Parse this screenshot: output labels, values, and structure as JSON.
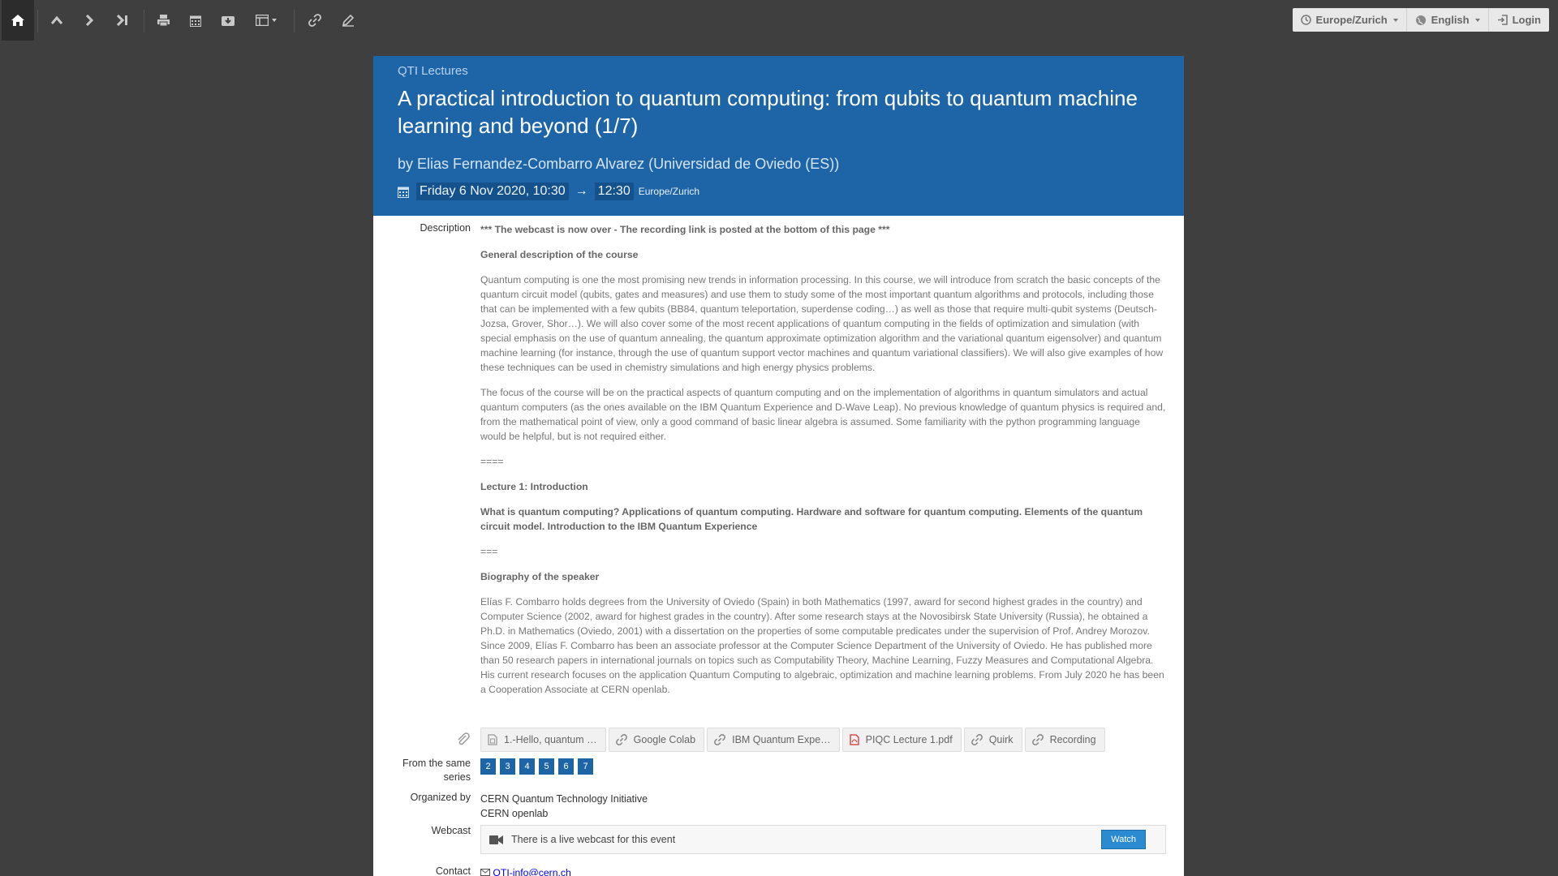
{
  "toolbar": {
    "timezone": "Europe/Zurich",
    "language": "English",
    "login": "Login",
    "icons": [
      "home-icon",
      "arrow-up-icon",
      "chevron-right-icon",
      "skip-last-icon",
      "print-icon",
      "calendar-icon",
      "download-icon",
      "layout-icon",
      "link-icon",
      "edit-icon"
    ]
  },
  "event": {
    "series": "QTI Lectures",
    "title": "A practical introduction to quantum computing: from qubits to quantum machine learning and beyond (1/7)",
    "speaker": "by Elias Fernandez-Combarro Alvarez (Universidad de Oviedo (ES))",
    "start": "Friday 6 Nov 2020, 10:30",
    "arrow": "→",
    "end": "12:30",
    "tz": "Europe/Zurich"
  },
  "description": {
    "label": "Description",
    "paragraphs": [
      "*** The webcast is now over - The recording link is posted at the bottom of this page ***",
      "General description of the course",
      "Quantum computing is one the most promising new trends in information processing. In this course, we will introduce from scratch the basic concepts of the quantum circuit model (qubits, gates and measures) and use them to study some of the most important quantum algorithms and protocols, including those that can be implemented with a few qubits (BB84, quantum teleportation, superdense coding…) as well as those that require multi-qubit systems (Deutsch-Jozsa, Grover, Shor…). We will also cover some of the most recent applications of quantum computing in the fields of optimization and simulation (with special emphasis on the use of quantum annealing, the quantum approximate optimization algorithm and the variational quantum eigensolver) and quantum machine learning (for instance, through the use of quantum support vector machines and quantum variational classifiers). We will also give examples of how these techniques can be used in chemistry simulations and high energy physics problems.",
      "The focus of the course will be on the practical aspects of quantum computing and on the implementation of algorithms in quantum simulators and actual quantum computers (as the ones available on the IBM Quantum Experience and D-Wave Leap). No previous knowledge of quantum physics is required and, from the mathematical point of view, only a good command of basic linear algebra is assumed. Some familiarity with the python programming language would be helpful, but is not required either.",
      "====",
      "Lecture 1: Introduction",
      "What is quantum computing? Applications of quantum computing. Hardware and software for quantum computing. Elements of the quantum circuit model. Introduction to the IBM Quantum Experience",
      "===",
      "Biography of the speaker",
      "Elías F. Combarro holds degrees from the University of Oviedo (Spain) in both Mathematics (1997, award for second highest grades in the country) and Computer Science (2002, award for highest grades in the country). After some research stays at the Novosibirsk State University (Russia), he obtained a Ph.D. in Mathematics (Oviedo, 2001) with a dissertation on the properties of some computable predicates under the supervision of Prof. Andrey Morozov. Since 2009, Elías F. Combarro has been an associate professor at the Computer Science Department of the University of Oviedo. He has published more than 50 research papers in international journals on topics such as Computability Theory, Machine Learning, Fuzzy Measures and Computational Algebra. His current research focuses on the application Quantum Computing to algebraic, optimization and machine learning problems. From July 2020 he has been a Cooperation Associate at CERN openlab."
    ]
  },
  "attachments": [
    {
      "label": "1.-Hello, quantum …",
      "icon": "file-icon"
    },
    {
      "label": "Google Colab",
      "icon": "link-icon"
    },
    {
      "label": "IBM Quantum Expe…",
      "icon": "link-icon"
    },
    {
      "label": "PIQC Lecture 1.pdf",
      "icon": "pdf-icon"
    },
    {
      "label": "Quirk",
      "icon": "link-icon"
    },
    {
      "label": "Recording",
      "icon": "link-icon"
    }
  ],
  "same_series": {
    "label_line1": "From the same",
    "label_line2": "series",
    "items": [
      "2",
      "3",
      "4",
      "5",
      "6",
      "7"
    ]
  },
  "organized": {
    "label": "Organized by",
    "lines": [
      "CERN Quantum Technology Initiative",
      "CERN openlab"
    ]
  },
  "webcast": {
    "label": "Webcast",
    "text": "There is a live webcast for this event",
    "button": "Watch"
  },
  "contact": {
    "label": "Contact",
    "email": "QTI-info@cern.ch"
  },
  "colors": {
    "header_bg": "#1e65a8",
    "toolbar_bg": "#3f3f3f",
    "accent": "#2b8ad0"
  }
}
